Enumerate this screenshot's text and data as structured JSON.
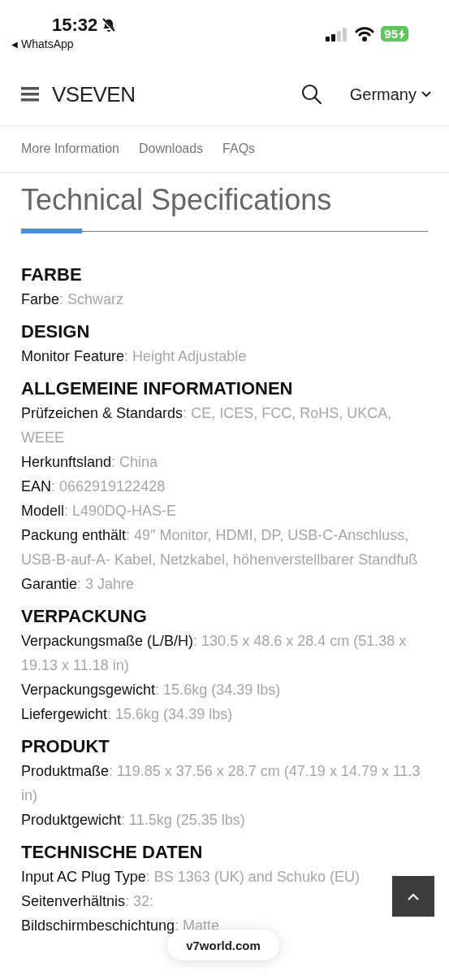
{
  "status_bar": {
    "time": "15:32",
    "back_arrow": "◀",
    "back_app": "WhatsApp",
    "battery": "95"
  },
  "header": {
    "logo": "VSEVEN",
    "country": "Germany"
  },
  "tabs": [
    {
      "label": "More Information",
      "selected": false
    },
    {
      "label": "Downloads",
      "selected": false
    },
    {
      "label": "FAQs",
      "selected": false
    }
  ],
  "title": "Technical Specifications",
  "sections": [
    {
      "heading": "FARBE",
      "specs": [
        {
          "label": "Farbe",
          "value": ": Schwarz"
        }
      ]
    },
    {
      "heading": "DESIGN",
      "specs": [
        {
          "label": "Monitor Feature",
          "value": ": Height Adjustable"
        }
      ]
    },
    {
      "heading": "ALLGEMEINE INFORMATIONEN",
      "specs": [
        {
          "label": "Prüfzeichen & Standards",
          "value": ": CE, ICES, FCC, RoHS, UKCA, WEEE"
        },
        {
          "label": "Herkunftsland",
          "value": ": China"
        },
        {
          "label": "EAN",
          "value": ": 0662919122428"
        },
        {
          "label": "Modell",
          "value": ": L490DQ-HAS-E"
        },
        {
          "label": "Packung enthält",
          "value": ": 49″ Monitor, HDMI, DP, USB-C-Anschluss, USB-B-auf-A- Kabel, Netzkabel, höhenverstellbarer Standfuß"
        },
        {
          "label": "Garantie",
          "value": ": 3 Jahre"
        }
      ]
    },
    {
      "heading": "VERPACKUNG",
      "specs": [
        {
          "label": "Verpackungsmaße (L/B/H)",
          "value": ": 130.5 x 48.6 x 28.4 cm (51.38 x 19.13 x 11.18 in)"
        },
        {
          "label": "Verpackungsgewicht",
          "value": ": 15.6kg (34.39 lbs)"
        },
        {
          "label": "Liefergewicht",
          "value": ": 15.6kg (34.39 lbs)"
        }
      ]
    },
    {
      "heading": "PRODUKT",
      "specs": [
        {
          "label": "Produktmaße",
          "value": ": 119.85 x 37.56 x 28.7 cm (47.19 x 14.79 x 11.3 in)"
        },
        {
          "label": "Produktgewicht",
          "value": ": 11.5kg (25.35 lbs)"
        }
      ]
    },
    {
      "heading": "TECHNISCHE DATEN",
      "specs": [
        {
          "label": "Input AC Plug Type",
          "value": ": BS 1363 (UK) and Schuko (EU)"
        },
        {
          "label": "Seitenverhältnis",
          "value": ": 32:"
        },
        {
          "label": "Bildschirmbeschichtung",
          "value": ": Matte"
        }
      ]
    }
  ],
  "url_pill": "v7world.com"
}
